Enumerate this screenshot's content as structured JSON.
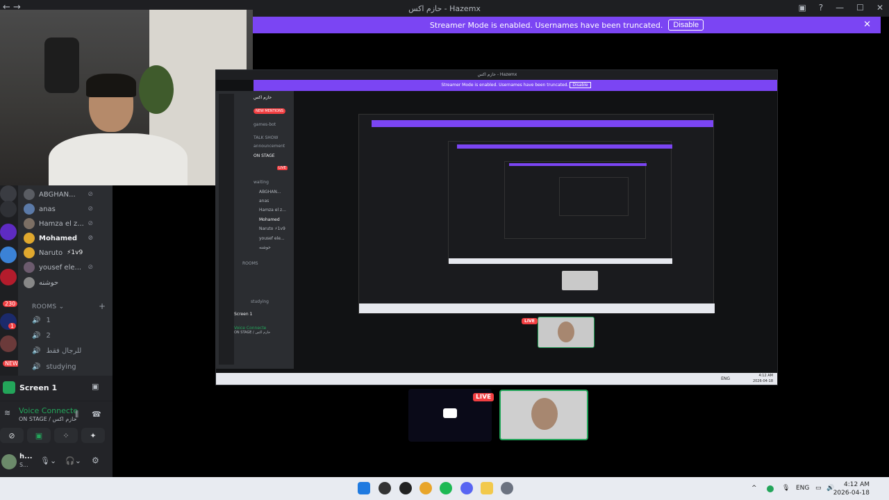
{
  "window": {
    "title": "حازم اكس - Hazemx"
  },
  "banner": {
    "text": "Streamer Mode is enabled. Usernames have been truncated.",
    "button": "Disable"
  },
  "guilds": {
    "badge_230": "230",
    "badge_1": "1",
    "badge_new": "NEW"
  },
  "members": [
    {
      "name": "ABGHAN..."
    },
    {
      "name": "anas"
    },
    {
      "name": "Hamza el z..."
    },
    {
      "name": "Mohamed"
    },
    {
      "name": "Naruto"
    },
    {
      "name": "yousef ele..."
    },
    {
      "name": "حوشنه"
    }
  ],
  "member_tag": "⚡1v9",
  "rooms": {
    "header": "ROOMS",
    "channels": [
      "1",
      "2",
      "للرجال فقط",
      "studying"
    ]
  },
  "screen": {
    "label": "Screen 1"
  },
  "voice": {
    "status": "Voice Connecte",
    "sub": "ON STAGE / حازم اكس"
  },
  "user": {
    "name": "h...",
    "status": "S..."
  },
  "nested": {
    "title": "حازم اكس - Hazemx",
    "banner": "Streamer Mode is enabled. Usernames have been truncated.",
    "disable": "Disable",
    "server": "حازم اكس",
    "mentions": "NEW MENTIONS",
    "channel_bot": "games-bot",
    "talk_show": "TALK SHOW",
    "announcement": "announcement",
    "on_stage": "ON STAGE",
    "waiting": "waiting",
    "rooms": "ROOMS",
    "studying": "studying",
    "screen": "Screen 1",
    "voice": "Voice Connecte",
    "voice_sub": "ON STAGE / حازم اكس",
    "members": [
      "ABGHAN...",
      "anas",
      "Hamza el z...",
      "Mohamed",
      "Naruto ⚡1v9",
      "yousef ele...",
      "حوشنه"
    ],
    "time": "4:12 AM",
    "date": "2026-04-18",
    "lang": "ENG"
  },
  "live": "LIVE",
  "taskbar": {
    "lang": "ENG",
    "time": "4:12 AM",
    "date": "2026-04-18"
  },
  "colors": {
    "accent": "#7b45f3",
    "live": "#f23f42",
    "online": "#23a55a"
  }
}
